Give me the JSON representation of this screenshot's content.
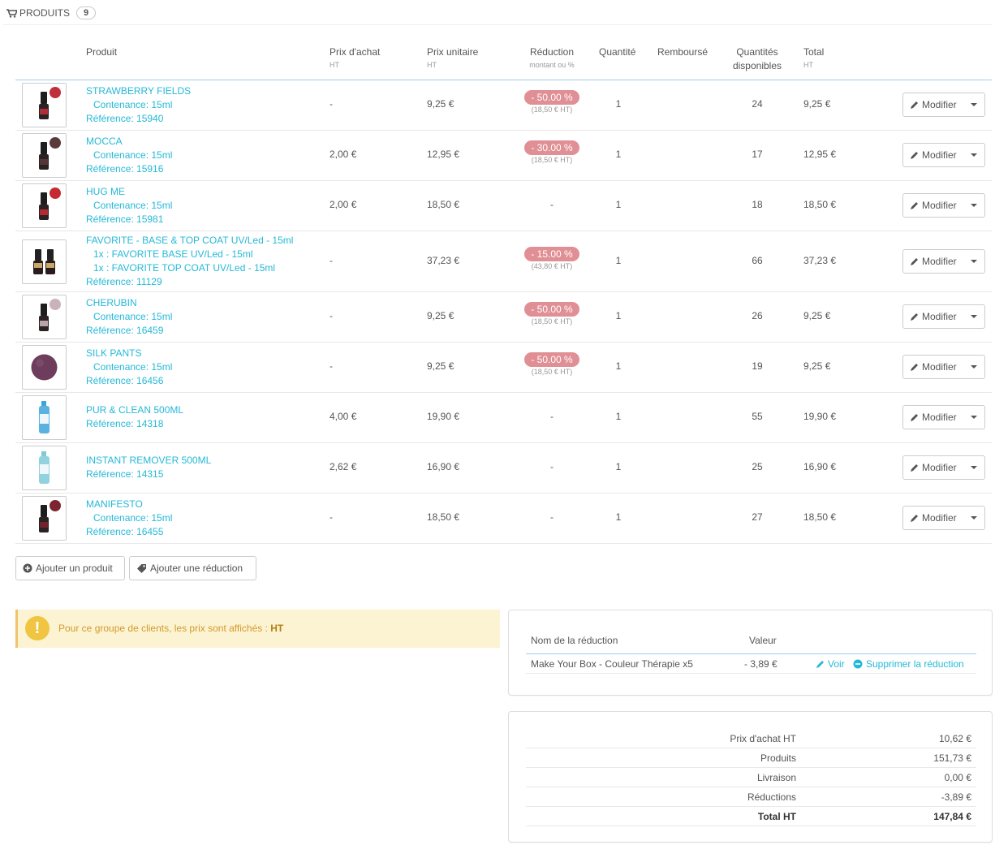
{
  "heading": {
    "title": "PRODUITS",
    "count": "9"
  },
  "columns": {
    "produit": "Produit",
    "prix_achat": "Prix d'achat",
    "prix_achat_sub": "HT",
    "prix_unitaire": "Prix unitaire",
    "prix_unitaire_sub": "HT",
    "reduction": "Réduction",
    "reduction_sub": "montant ou %",
    "quantite": "Quantité",
    "rembourse": "Remboursé",
    "quantites_disponibles_1": "Quantités",
    "quantites_disponibles_2": "disponibles",
    "total": "Total",
    "total_sub": "HT"
  },
  "modify_label": "Modifier",
  "products": [
    {
      "name": "STRAWBERRY FIELDS",
      "lines": [
        "Contenance: 15ml"
      ],
      "ref": "Référence: 15940",
      "achat": "-",
      "unit": "9,25 €",
      "red_badge": "- 50.00 %",
      "red_sub": "(18,50 € HT)",
      "red_plain": "",
      "qty": "1",
      "avail": "24",
      "total": "9,25 €",
      "thumb": "bottle-dot",
      "dot": "#c0303c"
    },
    {
      "name": "MOCCA",
      "lines": [
        "Contenance: 15ml"
      ],
      "ref": "Référence: 15916",
      "achat": "2,00 €",
      "unit": "12,95 €",
      "red_badge": "- 30.00 %",
      "red_sub": "(18,50 € HT)",
      "red_plain": "",
      "qty": "1",
      "avail": "17",
      "total": "12,95 €",
      "thumb": "bottle-dot",
      "dot": "#5a3a3a"
    },
    {
      "name": "HUG ME",
      "lines": [
        "Contenance: 15ml"
      ],
      "ref": "Référence: 15981",
      "achat": "2,00 €",
      "unit": "18,50 €",
      "red_badge": "",
      "red_sub": "",
      "red_plain": "-",
      "qty": "1",
      "avail": "18",
      "total": "18,50 €",
      "thumb": "bottle-dot",
      "dot": "#c42a32"
    },
    {
      "name": "FAVORITE - BASE & TOP COAT UV/Led - 15ml",
      "lines": [
        "1x : FAVORITE BASE UV/Led - 15ml",
        "1x : FAVORITE TOP COAT UV/Led - 15ml"
      ],
      "ref": "Référence: 11129",
      "achat": "-",
      "unit": "37,23 €",
      "red_badge": "- 15.00 %",
      "red_sub": "(43,80 € HT)",
      "red_plain": "",
      "qty": "1",
      "avail": "66",
      "total": "37,23 €",
      "thumb": "two-bottles",
      "dot": ""
    },
    {
      "name": "CHERUBIN",
      "lines": [
        "Contenance: 15ml"
      ],
      "ref": "Référence: 16459",
      "achat": "-",
      "unit": "9,25 €",
      "red_badge": "- 50.00 %",
      "red_sub": "(18,50 € HT)",
      "red_plain": "",
      "qty": "1",
      "avail": "26",
      "total": "9,25 €",
      "thumb": "bottle-dot",
      "dot": "#c9b3b8"
    },
    {
      "name": "SILK PANTS",
      "lines": [
        "Contenance: 15ml"
      ],
      "ref": "Référence: 16456",
      "achat": "-",
      "unit": "9,25 €",
      "red_badge": "- 50.00 %",
      "red_sub": "(18,50 € HT)",
      "red_plain": "",
      "qty": "1",
      "avail": "19",
      "total": "9,25 €",
      "thumb": "swatch",
      "dot": "#6e3c5c"
    },
    {
      "name": "PUR & CLEAN 500ML",
      "lines": [],
      "ref": "Référence: 14318",
      "achat": "4,00 €",
      "unit": "19,90 €",
      "red_badge": "",
      "red_sub": "",
      "red_plain": "-",
      "qty": "1",
      "avail": "55",
      "total": "19,90 €",
      "thumb": "blue-bottle",
      "dot": "#3da5dc"
    },
    {
      "name": "INSTANT REMOVER 500ML",
      "lines": [],
      "ref": "Référence: 14315",
      "achat": "2,62 €",
      "unit": "16,90 €",
      "red_badge": "",
      "red_sub": "",
      "red_plain": "-",
      "qty": "1",
      "avail": "25",
      "total": "16,90 €",
      "thumb": "blue-bottle",
      "dot": "#7fcad8"
    },
    {
      "name": "MANIFESTO",
      "lines": [
        "Contenance: 15ml"
      ],
      "ref": "Référence: 16455",
      "achat": "-",
      "unit": "18,50 €",
      "red_badge": "",
      "red_sub": "",
      "red_plain": "-",
      "qty": "1",
      "avail": "27",
      "total": "18,50 €",
      "thumb": "bottle-dot",
      "dot": "#7a2530"
    }
  ],
  "buttons": {
    "add_product": "Ajouter un produit",
    "add_discount": "Ajouter une réduction"
  },
  "warning": {
    "text": "Pour ce groupe de clients, les prix sont affichés :",
    "value": "HT"
  },
  "discounts": {
    "col_name": "Nom de la réduction",
    "col_value": "Valeur",
    "row_name": "Make Your Box - Couleur Thérapie x5",
    "row_value": "- 3,89 €",
    "view": "Voir",
    "delete": "Supprimer la réduction"
  },
  "totals": [
    {
      "label": "Prix d'achat HT",
      "value": "10,62 €"
    },
    {
      "label": "Produits",
      "value": "151,73 €"
    },
    {
      "label": "Livraison",
      "value": "0,00 €"
    },
    {
      "label": "Réductions",
      "value": "-3,89 €"
    },
    {
      "label": "Total HT",
      "value": "147,84 €"
    }
  ],
  "colors": {
    "link": "#25b9d7",
    "badge": "#e08f95",
    "warning_bg": "#fcf3d3",
    "warning_icon": "#f0c541"
  }
}
